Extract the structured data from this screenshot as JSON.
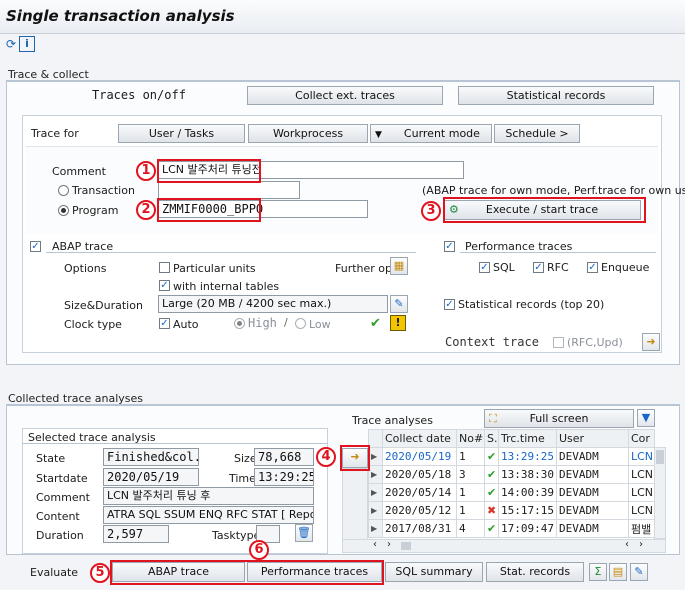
{
  "title": "Single transaction analysis",
  "sections": {
    "trace_collect": "Trace & collect",
    "collected": "Collected trace analyses"
  },
  "trace_tabs": {
    "onoff": "Traces on/off",
    "collect_ext": "Collect ext. traces",
    "statistical": "Statistical records"
  },
  "trace_for": {
    "label": "Trace for",
    "user_tasks": "User / Tasks",
    "workprocess": "Workprocess",
    "current_mode": "Current mode",
    "schedule": "Schedule >"
  },
  "form": {
    "comment_label": "Comment",
    "comment_value": "LCN 발주처리 튜닝전",
    "transaction_label": "Transaction",
    "transaction_value": "",
    "program_label": "Program",
    "program_value": "ZMMIF0000_BPPO",
    "hint": "(ABAP trace for own mode, Perf.trace for own user)",
    "execute_button": "Execute / start trace"
  },
  "abap_trace": {
    "title": "ABAP trace",
    "options_label": "Options",
    "particular_units": "Particular units",
    "with_internal_tables": "with internal tables",
    "further_opt": "Further opt.",
    "size_duration_label": "Size&Duration",
    "size_duration_value": "Large (20 MB / 4200 sec max.)",
    "clock_type_label": "Clock type",
    "auto": "Auto",
    "high": "High",
    "slash": "/",
    "low": "Low",
    "warn": "!"
  },
  "perf_traces": {
    "title": "Performance traces",
    "sql": "SQL",
    "rfc": "RFC",
    "enqueue": "Enqueue",
    "statistical_records": "Statistical records (top 20)",
    "context_trace": "Context trace",
    "rfc_upd": "(RFC,Upd)"
  },
  "selected": {
    "title": "Selected trace analysis",
    "state_label": "State",
    "state_value": "Finished&col.",
    "size_label": "Size",
    "size_value": "78,668",
    "startdate_label": "Startdate",
    "startdate_value": "2020/05/19",
    "time_label": "Time",
    "time_value": "13:29:25",
    "comment_label": "Comment",
    "comment_value": "LCN 발주처리 튜닝 후",
    "content_label": "Content",
    "content_value": "ATRA SQL SSUM ENQ RFC STAT [ Report=...",
    "duration_label": "Duration",
    "duration_value": "2,597",
    "tasktype_label": "Tasktype"
  },
  "analyses": {
    "title": "Trace analyses",
    "full_screen": "Full screen",
    "columns": [
      "Collect date",
      "No#",
      "S..",
      "Trc.time",
      "User",
      "Cor"
    ],
    "rows": [
      {
        "date": "2020/05/19",
        "no": "1",
        "status": "ok",
        "time": "13:29:25",
        "user": "DEVADM",
        "cor": "LCN"
      },
      {
        "date": "2020/05/18",
        "no": "3",
        "status": "ok",
        "time": "13:38:30",
        "user": "DEVADM",
        "cor": "LCN"
      },
      {
        "date": "2020/05/14",
        "no": "1",
        "status": "ok",
        "time": "14:00:39",
        "user": "DEVADM",
        "cor": "LCN"
      },
      {
        "date": "2020/05/12",
        "no": "1",
        "status": "err",
        "time": "15:17:15",
        "user": "DEVADM",
        "cor": "LCN"
      },
      {
        "date": "2017/08/31",
        "no": "4",
        "status": "ok",
        "time": "17:09:47",
        "user": "DEVADM",
        "cor": "펌밸"
      }
    ]
  },
  "evaluate": {
    "label": "Evaluate",
    "abap_trace": "ABAP trace",
    "performance_traces": "Performance traces",
    "sql_summary": "SQL summary",
    "stat_records": "Stat. records"
  },
  "markers": [
    "1",
    "2",
    "3",
    "4",
    "5",
    "6"
  ],
  "colors": {
    "highlight": "#e0141e",
    "accent_blue": "#1767c8",
    "ok_green": "#2aa02a"
  }
}
